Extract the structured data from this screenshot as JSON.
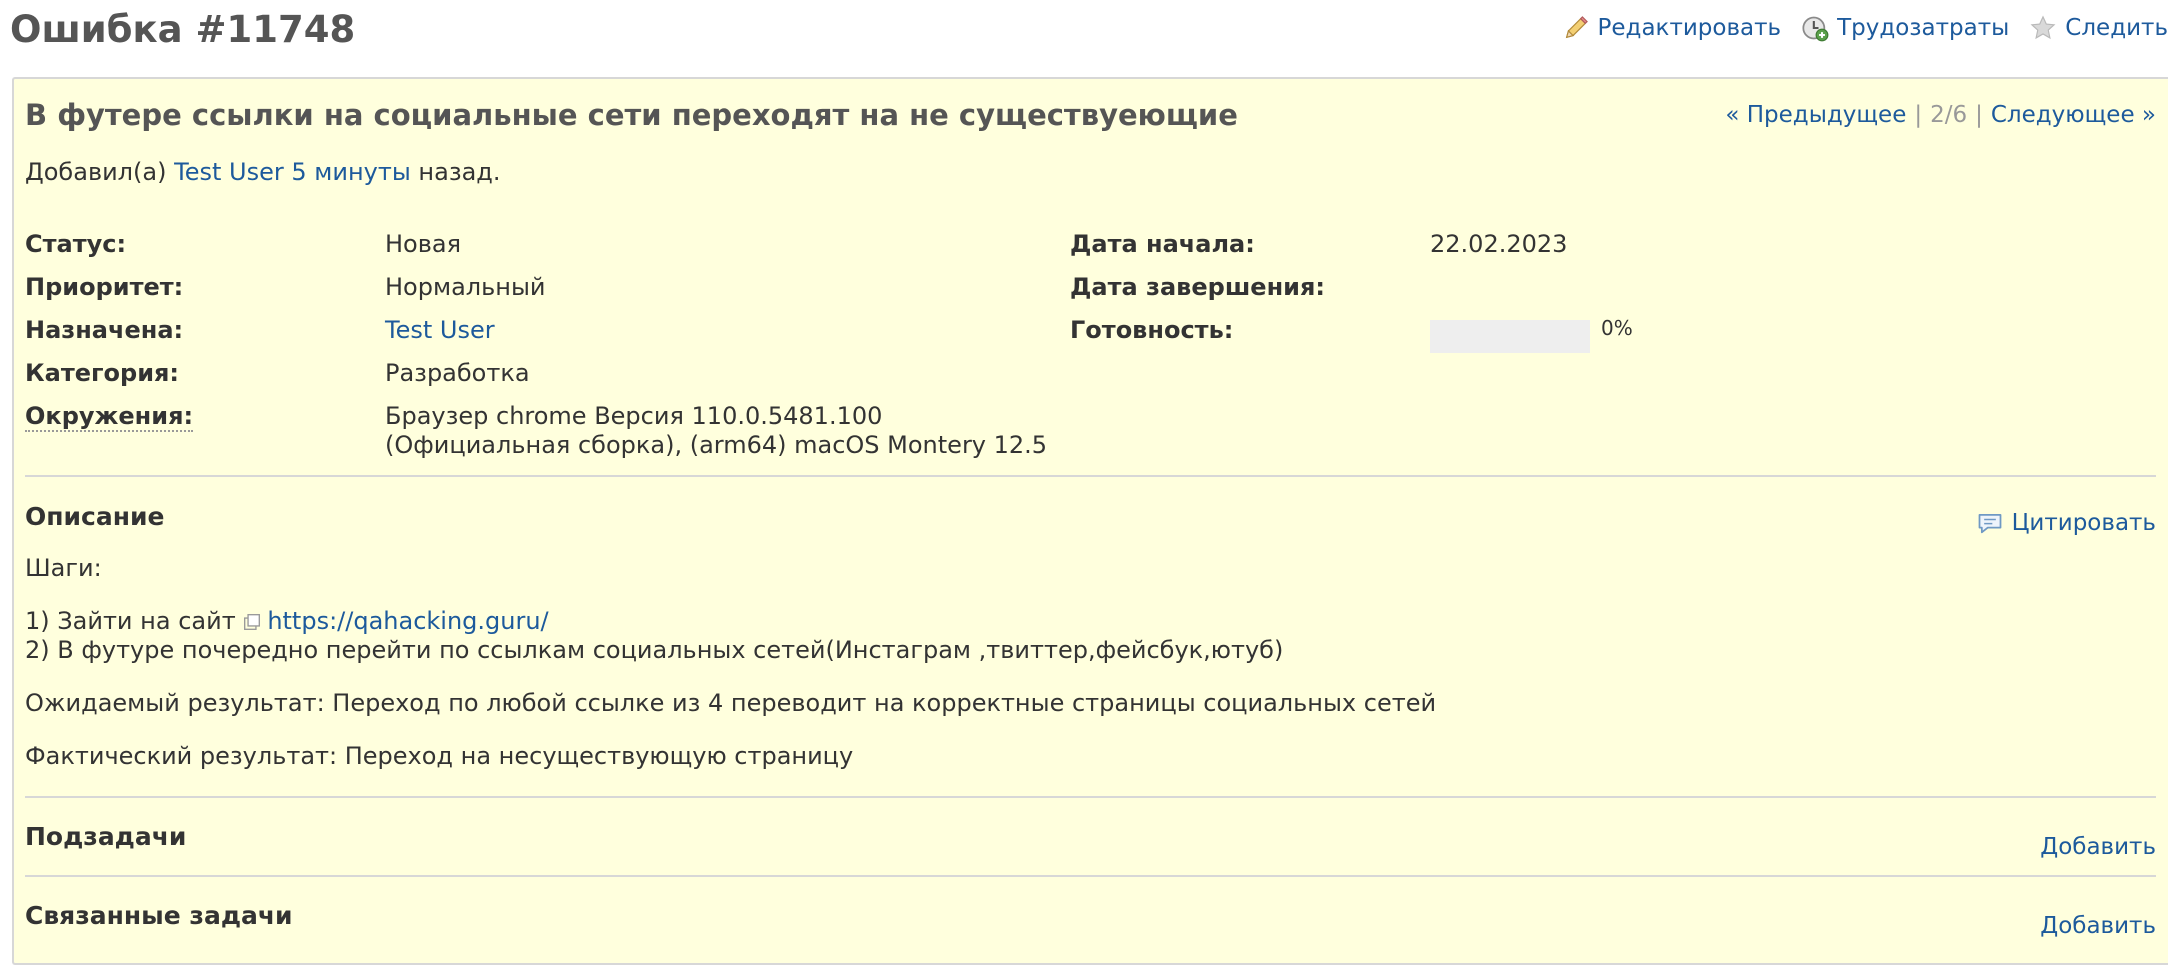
{
  "page": {
    "title": "Ошибка #11748"
  },
  "toolbar": {
    "edit_label": "Редактировать",
    "time_label": "Трудозатраты",
    "watch_label": "Следить"
  },
  "issue": {
    "subject": "В футере ссылки на социальные сети переходят на не существуеющие",
    "nav": {
      "prev_label": "« Предыдущее",
      "position": "2/6",
      "next_label": "Следующее »"
    },
    "author": {
      "prefix": "Добавил(а)",
      "user": "Test User",
      "age": "5 минуты",
      "suffix": "назад."
    },
    "attributes": {
      "status_label": "Статус:",
      "status_value": "Новая",
      "priority_label": "Приоритет:",
      "priority_value": "Нормальный",
      "assignee_label": "Назначена:",
      "assignee_value": "Test User",
      "category_label": "Категория:",
      "category_value": "Разработка",
      "environment_label": "Окружения:",
      "environment_line1": "Браузер chrome Версия 110.0.5481.100",
      "environment_line2": "(Официальная сборка), (arm64) macOS Montery 12.5",
      "start_date_label": "Дата начала:",
      "start_date_value": "22.02.2023",
      "due_date_label": "Дата завершения:",
      "due_date_value": "",
      "done_label": "Готовность:",
      "done_ratio": 0,
      "done_text": "0%"
    },
    "description": {
      "title": "Описание",
      "quote_label": "Цитировать",
      "steps_heading": "Шаги:",
      "step1_prefix": "1) Зайти на сайт",
      "step1_link": "https://qahacking.guru/",
      "step2": "2) В футуре почередно перейти по ссылкам социальных сетей(Инстаграм ,твиттер,фейсбук,ютуб)",
      "expected": "Ожидаемый результат: Переход по любой ссылке из 4 переводит на корректные страницы социальных сетей",
      "actual": "Фактический результат: Переход на несуществующую страницу"
    },
    "subtasks": {
      "title": "Подзадачи",
      "add_label": "Добавить"
    },
    "relations": {
      "title": "Связанные задачи",
      "add_label": "Добавить"
    }
  },
  "colors": {
    "link": "#1d5a9c",
    "box_background": "#ffffdd",
    "title_text": "#555555",
    "border": "#d7d7d7"
  },
  "icons": [
    "edit-pencil-icon",
    "time-clock-icon",
    "watch-star-icon",
    "quote-bubble-icon",
    "external-link-icon"
  ]
}
